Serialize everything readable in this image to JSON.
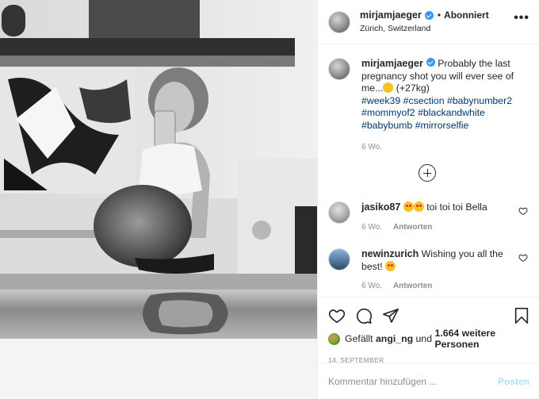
{
  "header": {
    "username": "mirjamjaeger",
    "separator": "•",
    "follow_state": "Abonniert",
    "location": "Zürich, Switzerland",
    "more": "•••"
  },
  "caption": {
    "username": "mirjamjaeger",
    "text": "Probably the last pregnancy shot you will ever see of me...",
    "text_suffix": " (+27kg)",
    "hashtags": "#week39 #csection #babynumber2 #mommyof2 #blackandwhite #babybumb #mirrorselfie",
    "time": "6 Wo."
  },
  "comments": [
    {
      "username": "jasiko87",
      "text": "toi toi toi Bella",
      "time": "6 Wo.",
      "reply": "Antworten"
    },
    {
      "username": "newinzurich",
      "text": "Wishing you all the best!",
      "time": "6 Wo.",
      "reply": "Antworten"
    }
  ],
  "likes": {
    "prefix": "Gefällt ",
    "user": "angi_ng",
    "middle": " und ",
    "count": "1.664 weitere Personen"
  },
  "date": "14. SEPTEMBER",
  "add_comment": {
    "placeholder": "Kommentar hinzufügen ...",
    "post_label": "Posten"
  },
  "icons": {
    "like": "heart-icon",
    "comment": "comment-icon",
    "share": "share-icon",
    "save": "bookmark-icon",
    "load_more": "plus-circle-icon",
    "verified": "verified-badge-icon"
  },
  "colors": {
    "link": "#00376b",
    "verified": "#3897f0",
    "muted": "#8e8e8e",
    "post_button_disabled": "#b2dffc"
  }
}
